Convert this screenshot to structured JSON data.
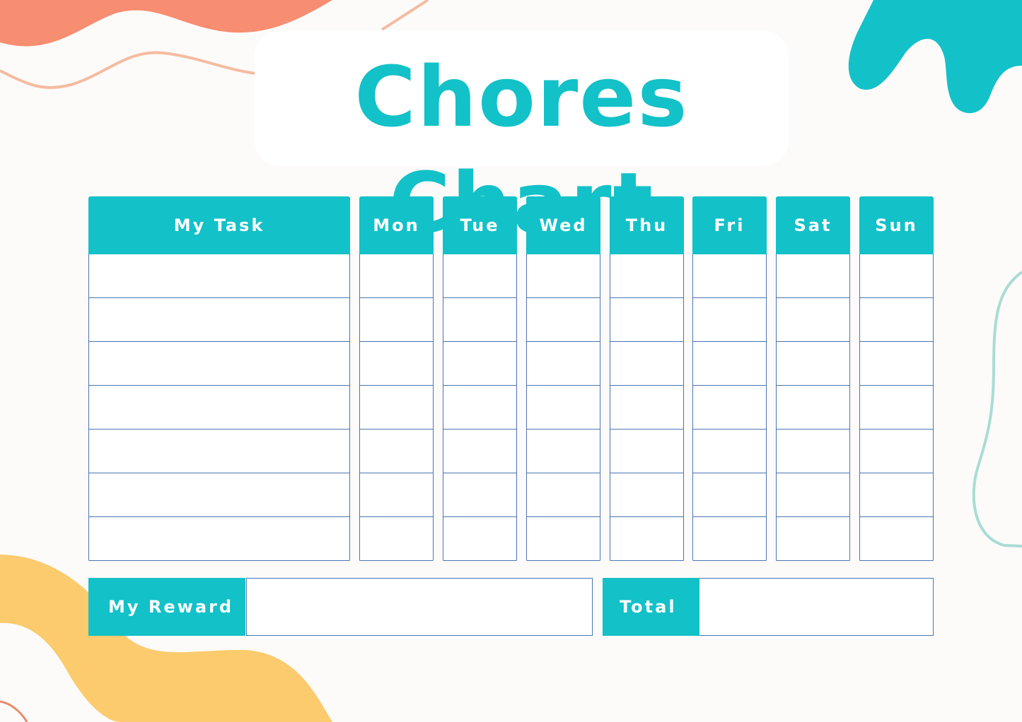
{
  "title": "Chores Chart",
  "colors": {
    "accent": "#13c1c8",
    "coral": "#f78d71",
    "peach_line": "#f5bba0",
    "yellow": "#fbcb6e",
    "mint_line": "#a9dcd5",
    "grid_border": "#4a74b4",
    "background": "#fcfbf9"
  },
  "table": {
    "task_header": "My Task",
    "days": [
      "Mon",
      "Tue",
      "Wed",
      "Thu",
      "Fri",
      "Sat",
      "Sun"
    ],
    "row_count": 7
  },
  "footer": {
    "reward_label": "My Reward",
    "reward_value": "",
    "total_label": "Total",
    "total_value": ""
  }
}
